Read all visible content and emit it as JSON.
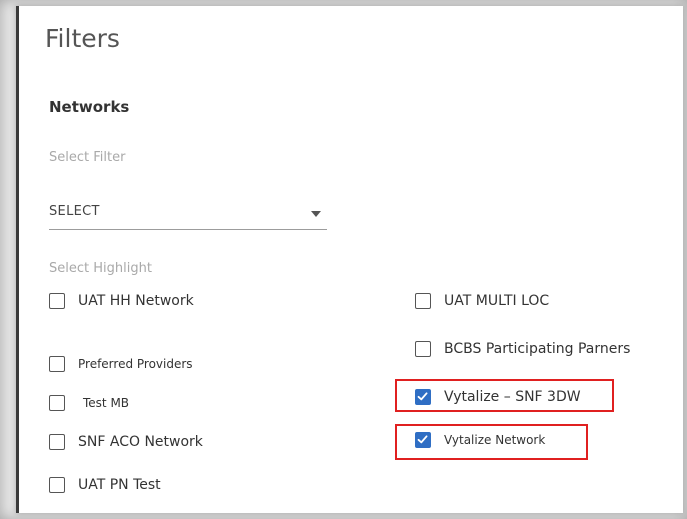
{
  "panel": {
    "title": "Filters",
    "section_heading": "Networks",
    "select_filter_label": "Select Filter",
    "select_value": "SELECT",
    "select_highlight_label": "Select Highlight"
  },
  "highlights": {
    "left": [
      {
        "label": "UAT HH Network",
        "checked": false
      },
      {
        "label": "Preferred Providers",
        "checked": false
      },
      {
        "label": "Test MB",
        "checked": false
      },
      {
        "label": "SNF ACO Network",
        "checked": false
      },
      {
        "label": "UAT PN Test",
        "checked": false
      }
    ],
    "right": [
      {
        "label": "UAT MULTI LOC",
        "checked": false
      },
      {
        "label": "BCBS Participating Parners",
        "checked": false
      },
      {
        "label": "Vytalize – SNF 3DW",
        "checked": true
      },
      {
        "label": "Vytalize Network",
        "checked": true
      }
    ]
  },
  "colors": {
    "checkbox_checked": "#2f6ec4",
    "annotation_red": "#e02020"
  }
}
